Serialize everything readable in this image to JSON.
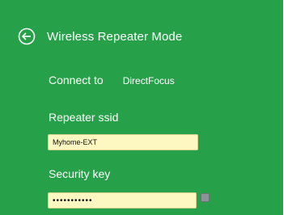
{
  "header": {
    "back_icon": "back-arrow-circle-icon",
    "title": "Wireless Repeater Mode"
  },
  "connect": {
    "label": "Connect to",
    "value": "DirectFocus"
  },
  "repeater_ssid": {
    "label": "Repeater ssid",
    "value": "Myhome-EXT"
  },
  "security_key": {
    "label": "Security key",
    "value": "•••••••••••",
    "show_toggle_checked": false
  },
  "colors": {
    "panel_bg": "#27a149",
    "input_bg": "#fdf7c1",
    "toggle": "#8c9396"
  }
}
